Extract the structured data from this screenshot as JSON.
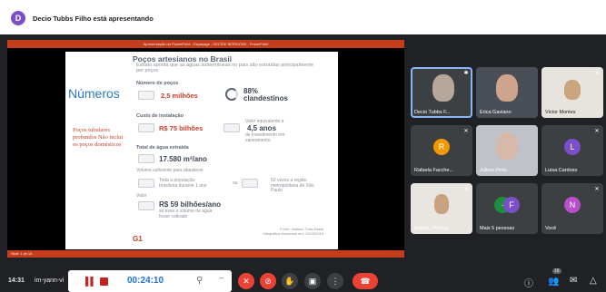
{
  "presenter": {
    "initial": "D",
    "text": "Decio Tubbs Filho está apresentando"
  },
  "ppt": {
    "window_title": "Apresentação do PowerPoint - Espaçage - DECÍDE BERSATAS - PowerPoint",
    "status": "Slide 1 de 18"
  },
  "slide": {
    "title": "Poços artesianos no Brasil",
    "subtitle": "Estudo aponta que as águas subterrâneas no país são extraídas principalmente por poços",
    "numeros": "Números",
    "side_note": "Poços tubulares profundos Não inclui os poços domésticos",
    "wells_label": "Número de poços",
    "wells_value": "2,5 milhões",
    "clandestine_value": "88%",
    "clandestine_label": "clandestinos",
    "install_label": "Custo de instalação",
    "install_value": "R$ 75 bilhões",
    "time_value": "4,5 anos",
    "time_note": "Valor equivalente a",
    "time_note2": "de investimento em saneamento",
    "extracted_label": "Total de água extraída",
    "extracted_value": "17.580 m³/ano",
    "supply_label": "Volume suficiente para abastecer",
    "supply_note": "Toda a população brasileira durante 1 ano",
    "or_text": "ou",
    "supply_note2": "50 vezes a região metropolitana de São Paulo",
    "value_label": "Valor",
    "value_big": "R$ 59 bilhões/ano",
    "value_note": "se esse o volume de água fosse cobrado",
    "logo": "G1",
    "footer1": "Fonte: Instituto Trata Brasil",
    "footer2": "Infográfico elaborado em: 12/03/2019"
  },
  "participants": [
    {
      "name": "Decio Tubbs F...",
      "type": "video",
      "skin": "#b7a79a",
      "bg": "#6b7687",
      "speaking": true
    },
    {
      "name": "Erica Gaviano",
      "type": "video",
      "skin": "#cfa48d",
      "bg": "#4a4e56",
      "speaking": false
    },
    {
      "name": "Victor Montes",
      "type": "video",
      "skin": "#caa37f",
      "bg": "#e7e4dd",
      "speaking": false
    },
    {
      "name": "Rafaela Facche...",
      "type": "avatar",
      "initial": "R",
      "color": "#f29900"
    },
    {
      "name": "Julieta Pinto",
      "type": "video",
      "skin": "#d6b9a8",
      "bg": "#bfc3c9",
      "speaking": false
    },
    {
      "name": "Luisa Cardoso",
      "type": "avatar",
      "initial": "L",
      "color": "#7b4fc9"
    },
    {
      "name": "Karina - Petróp...",
      "type": "video",
      "skin": "#c9a27f",
      "bg": "#e9e6e1",
      "speaking": false
    },
    {
      "name": "Mais 5 pessoas",
      "type": "more",
      "initial": "F",
      "color": "#1e8e3e"
    },
    {
      "name": "Você",
      "type": "avatar",
      "initial": "N",
      "color": "#b64fc9"
    }
  ],
  "bottom": {
    "clock": "14:31",
    "meeting_code": "im-yann-vi",
    "timer": "00:24:10",
    "participant_count": "16"
  },
  "colors": {
    "accent": "#1a73e8",
    "danger": "#ea4335",
    "dark": "#202124"
  },
  "icons": [
    "mic-off-icon",
    "video-off-icon",
    "hand-icon",
    "present-icon",
    "more-icon",
    "end-call-icon",
    "info-icon",
    "people-icon",
    "chat-icon",
    "activities-icon"
  ]
}
